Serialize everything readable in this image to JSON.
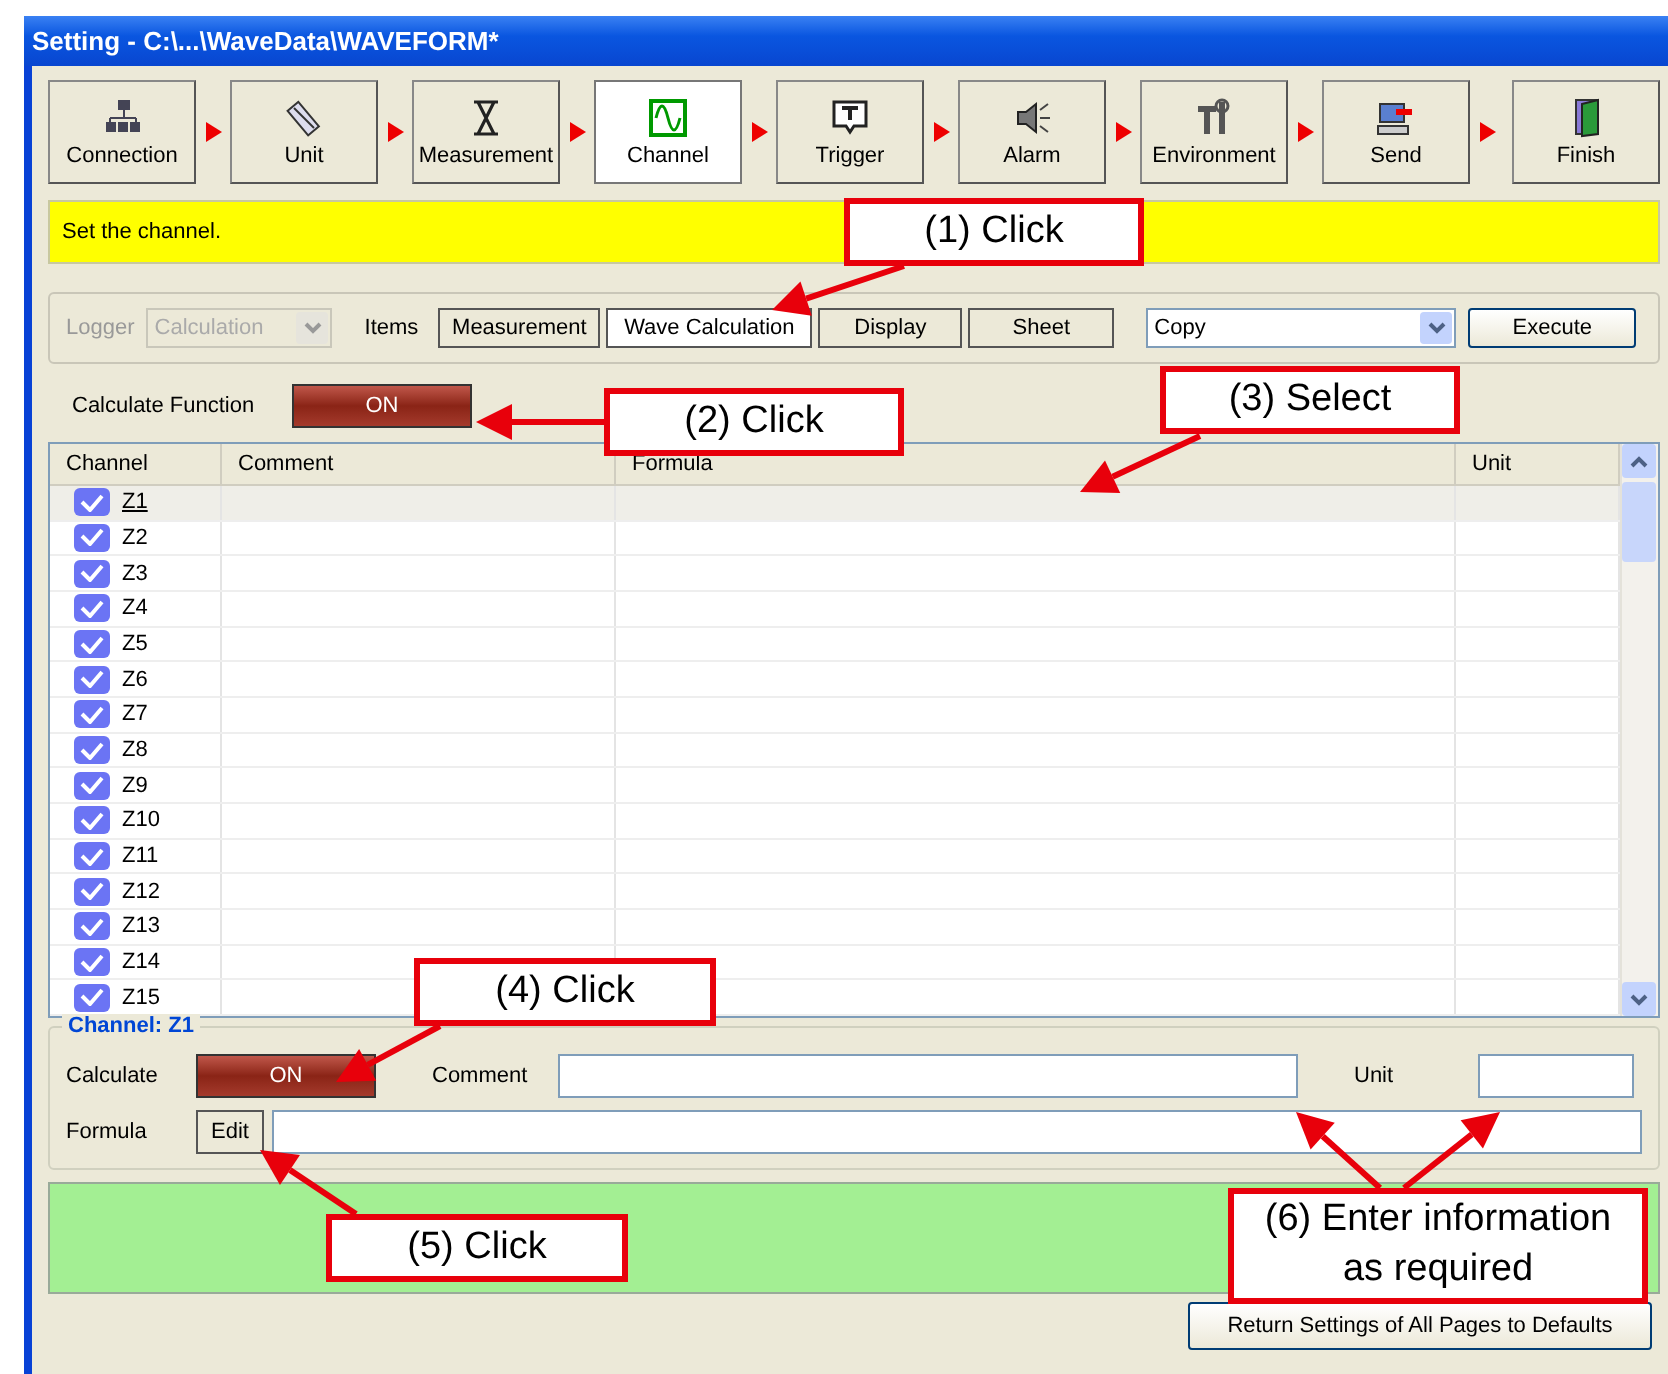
{
  "window": {
    "title": "Setting - C:\\...\\WaveData\\WAVEFORM*"
  },
  "steps": [
    {
      "label": "Connection",
      "kind": "connection",
      "selected": false
    },
    {
      "label": "Unit",
      "kind": "unit",
      "selected": false
    },
    {
      "label": "Measurement",
      "kind": "measurement",
      "selected": false
    },
    {
      "label": "Channel",
      "kind": "channel",
      "selected": true
    },
    {
      "label": "Trigger",
      "kind": "trigger",
      "selected": false
    },
    {
      "label": "Alarm",
      "kind": "alarm",
      "selected": false
    },
    {
      "label": "Environment",
      "kind": "environment",
      "selected": false
    },
    {
      "label": "Send",
      "kind": "send",
      "selected": false
    }
  ],
  "finish": {
    "label": "Finish"
  },
  "hint": "Set the channel.",
  "items_bar": {
    "logger_label": "Logger",
    "logger_value": "Calculation",
    "logger_disabled": true,
    "items_label": "Items",
    "tabs": [
      {
        "label": "Measurement",
        "selected": false
      },
      {
        "label": "Wave Calculation",
        "selected": true
      },
      {
        "label": "Display",
        "selected": false
      },
      {
        "label": "Sheet",
        "selected": false
      }
    ],
    "action_value": "Copy",
    "execute": "Execute"
  },
  "calculate_function": {
    "label": "Calculate Function",
    "button": "ON",
    "on": true
  },
  "table": {
    "columns": [
      "Channel",
      "Comment",
      "Formula",
      "Unit"
    ],
    "rows": [
      {
        "channel": "Z1",
        "checked": true,
        "selected": true
      },
      {
        "channel": "Z2",
        "checked": true,
        "selected": false
      },
      {
        "channel": "Z3",
        "checked": true,
        "selected": false
      },
      {
        "channel": "Z4",
        "checked": true,
        "selected": false
      },
      {
        "channel": "Z5",
        "checked": true,
        "selected": false
      },
      {
        "channel": "Z6",
        "checked": true,
        "selected": false
      },
      {
        "channel": "Z7",
        "checked": true,
        "selected": false
      },
      {
        "channel": "Z8",
        "checked": true,
        "selected": false
      },
      {
        "channel": "Z9",
        "checked": true,
        "selected": false
      },
      {
        "channel": "Z10",
        "checked": true,
        "selected": false
      },
      {
        "channel": "Z11",
        "checked": true,
        "selected": false
      },
      {
        "channel": "Z12",
        "checked": true,
        "selected": false
      },
      {
        "channel": "Z13",
        "checked": true,
        "selected": false
      },
      {
        "channel": "Z14",
        "checked": true,
        "selected": false
      },
      {
        "channel": "Z15",
        "checked": true,
        "selected": false
      }
    ]
  },
  "channel_group": {
    "title": "Channel: Z1",
    "calculate_label": "Calculate",
    "calculate_button": "ON",
    "on": true,
    "comment_label": "Comment",
    "unit_label": "Unit",
    "formula_label": "Formula",
    "edit_button": "Edit"
  },
  "reset_button": "Return Settings of All Pages to Defaults",
  "callouts": [
    {
      "text": "(1) Click"
    },
    {
      "text": "(2) Click"
    },
    {
      "text": "(3) Select"
    },
    {
      "text": "(4) Click"
    },
    {
      "text": "(5) Click"
    },
    {
      "text": "(6) Enter information as required"
    }
  ]
}
